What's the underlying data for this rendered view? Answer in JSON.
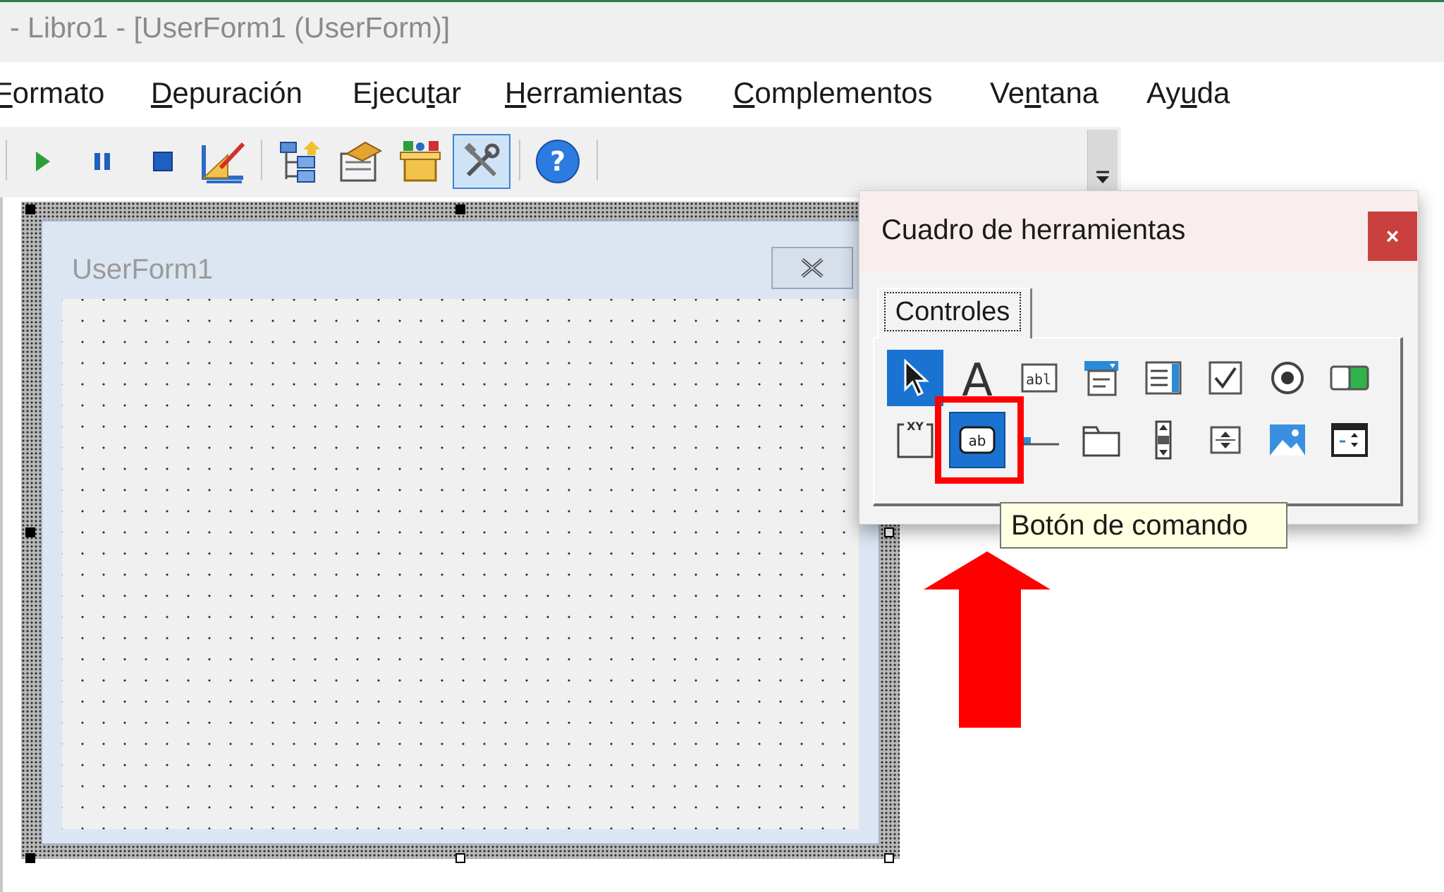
{
  "window": {
    "title": "- Libro1 - [UserForm1 (UserForm)]"
  },
  "menu": {
    "items": [
      {
        "label": "Formato",
        "accelerator": "F"
      },
      {
        "label": "Depuración",
        "accelerator": "D"
      },
      {
        "label": "Ejecutar",
        "accelerator": "t"
      },
      {
        "label": "Herramientas",
        "accelerator": "H"
      },
      {
        "label": "Complementos",
        "accelerator": "C"
      },
      {
        "label": "Ventana",
        "accelerator": "n"
      },
      {
        "label": "Ayuda",
        "accelerator": "u"
      }
    ]
  },
  "toolbar": {
    "buttons": [
      {
        "icon": "run-icon",
        "color": "#2e9e3a"
      },
      {
        "icon": "pause-icon",
        "color": "#1f5fbf"
      },
      {
        "icon": "stop-icon",
        "color": "#1f5fbf"
      },
      {
        "icon": "design-mode-icon",
        "color": "#e0a020"
      },
      {
        "icon": "project-explorer-icon",
        "color": "#2b6cc4"
      },
      {
        "icon": "properties-window-icon",
        "color": "#c8891e"
      },
      {
        "icon": "object-browser-icon",
        "color": "#e0b020"
      },
      {
        "icon": "toolbox-icon",
        "color": "#555555",
        "pressed": true
      },
      {
        "icon": "help-icon",
        "color": "#2b7be0"
      }
    ]
  },
  "userform": {
    "title": "UserForm1"
  },
  "toolbox": {
    "title": "Cuadro de herramientas",
    "close_label": "×",
    "tab_label": "Controles",
    "controls_row1": [
      {
        "icon": "select-pointer-icon",
        "selected": true
      },
      {
        "icon": "label-control-icon"
      },
      {
        "icon": "textbox-icon"
      },
      {
        "icon": "combobox-icon"
      },
      {
        "icon": "listbox-icon"
      },
      {
        "icon": "checkbox-icon"
      },
      {
        "icon": "option-button-icon"
      },
      {
        "icon": "toggle-button-icon"
      }
    ],
    "controls_row2": [
      {
        "icon": "frame-icon"
      },
      {
        "icon": "command-button-icon",
        "selected": true
      },
      {
        "icon": "tabstrip-icon"
      },
      {
        "icon": "multipage-icon"
      },
      {
        "icon": "scrollbar-icon"
      },
      {
        "icon": "spinbutton-icon"
      },
      {
        "icon": "image-control-icon"
      },
      {
        "icon": "refedit-icon"
      }
    ],
    "tooltip": "Botón de comando"
  },
  "colors": {
    "accent_selection": "#1a73d1",
    "annotation_red": "#ff0000",
    "tooltip_bg": "#ffffe1",
    "close_red": "#c9403f"
  }
}
